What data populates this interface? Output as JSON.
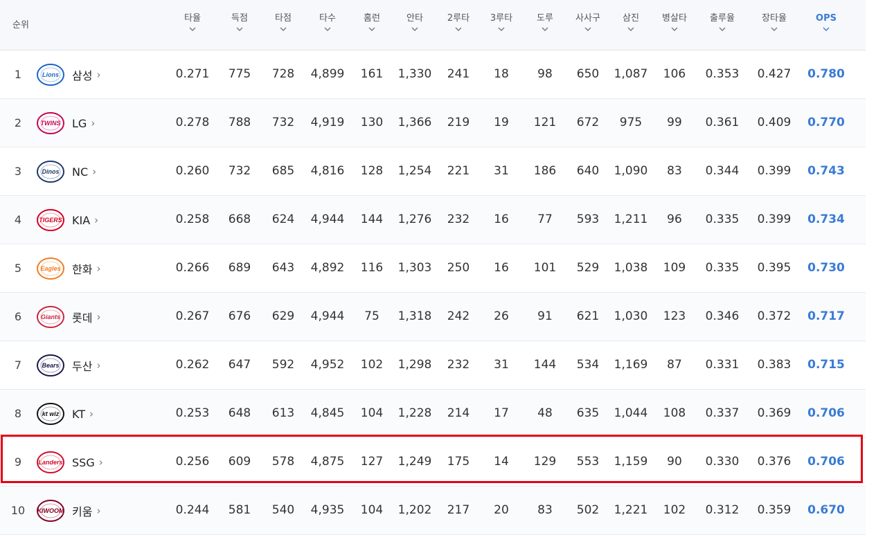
{
  "header": {
    "rank_label": "순위",
    "columns": [
      "타율",
      "득점",
      "타점",
      "타수",
      "홈런",
      "안타",
      "2루타",
      "3루타",
      "도루",
      "사사구",
      "삼진",
      "병살타",
      "출루율",
      "장타율",
      "OPS"
    ],
    "active_column": "OPS"
  },
  "colors": {
    "accent": "#3a7bd5",
    "highlight": "#e60012"
  },
  "highlighted_row": 9,
  "rows": [
    {
      "rank": "1",
      "team": "삼성",
      "logo": "Lions",
      "logo_color": "#1d64c8",
      "stats": [
        "0.271",
        "775",
        "728",
        "4,899",
        "161",
        "1,330",
        "241",
        "18",
        "98",
        "650",
        "1,087",
        "106",
        "0.353",
        "0.427",
        "0.780"
      ]
    },
    {
      "rank": "2",
      "team": "LG",
      "logo": "TWINS",
      "logo_color": "#c30452",
      "stats": [
        "0.278",
        "788",
        "732",
        "4,919",
        "130",
        "1,366",
        "219",
        "19",
        "121",
        "672",
        "975",
        "99",
        "0.361",
        "0.409",
        "0.770"
      ]
    },
    {
      "rank": "3",
      "team": "NC",
      "logo": "Dinos",
      "logo_color": "#1f3a6a",
      "stats": [
        "0.260",
        "732",
        "685",
        "4,816",
        "128",
        "1,254",
        "221",
        "31",
        "186",
        "640",
        "1,090",
        "83",
        "0.344",
        "0.399",
        "0.743"
      ]
    },
    {
      "rank": "4",
      "team": "KIA",
      "logo": "TIGERS",
      "logo_color": "#d2001f",
      "stats": [
        "0.258",
        "668",
        "624",
        "4,944",
        "144",
        "1,276",
        "232",
        "16",
        "77",
        "593",
        "1,211",
        "96",
        "0.335",
        "0.399",
        "0.734"
      ]
    },
    {
      "rank": "5",
      "team": "한화",
      "logo": "Eagles",
      "logo_color": "#f07c22",
      "stats": [
        "0.266",
        "689",
        "643",
        "4,892",
        "116",
        "1,303",
        "250",
        "16",
        "101",
        "529",
        "1,038",
        "109",
        "0.335",
        "0.395",
        "0.730"
      ]
    },
    {
      "rank": "6",
      "team": "롯데",
      "logo": "Giants",
      "logo_color": "#c9243f",
      "stats": [
        "0.267",
        "676",
        "629",
        "4,944",
        "75",
        "1,318",
        "242",
        "26",
        "91",
        "621",
        "1,030",
        "123",
        "0.346",
        "0.372",
        "0.717"
      ]
    },
    {
      "rank": "7",
      "team": "두산",
      "logo": "Bears",
      "logo_color": "#1a1748",
      "stats": [
        "0.262",
        "647",
        "592",
        "4,952",
        "102",
        "1,298",
        "232",
        "31",
        "144",
        "534",
        "1,169",
        "87",
        "0.331",
        "0.383",
        "0.715"
      ]
    },
    {
      "rank": "8",
      "team": "KT",
      "logo": "kt wiz",
      "logo_color": "#111111",
      "stats": [
        "0.253",
        "648",
        "613",
        "4,845",
        "104",
        "1,228",
        "214",
        "17",
        "48",
        "635",
        "1,044",
        "108",
        "0.337",
        "0.369",
        "0.706"
      ]
    },
    {
      "rank": "9",
      "team": "SSG",
      "logo": "Landers",
      "logo_color": "#ce0e2d",
      "stats": [
        "0.256",
        "609",
        "578",
        "4,875",
        "127",
        "1,249",
        "175",
        "14",
        "129",
        "553",
        "1,159",
        "90",
        "0.330",
        "0.376",
        "0.706"
      ]
    },
    {
      "rank": "10",
      "team": "키움",
      "logo": "KIWOOM",
      "logo_color": "#820024",
      "stats": [
        "0.244",
        "581",
        "540",
        "4,935",
        "104",
        "1,202",
        "217",
        "20",
        "83",
        "502",
        "1,221",
        "102",
        "0.312",
        "0.359",
        "0.670"
      ]
    }
  ]
}
